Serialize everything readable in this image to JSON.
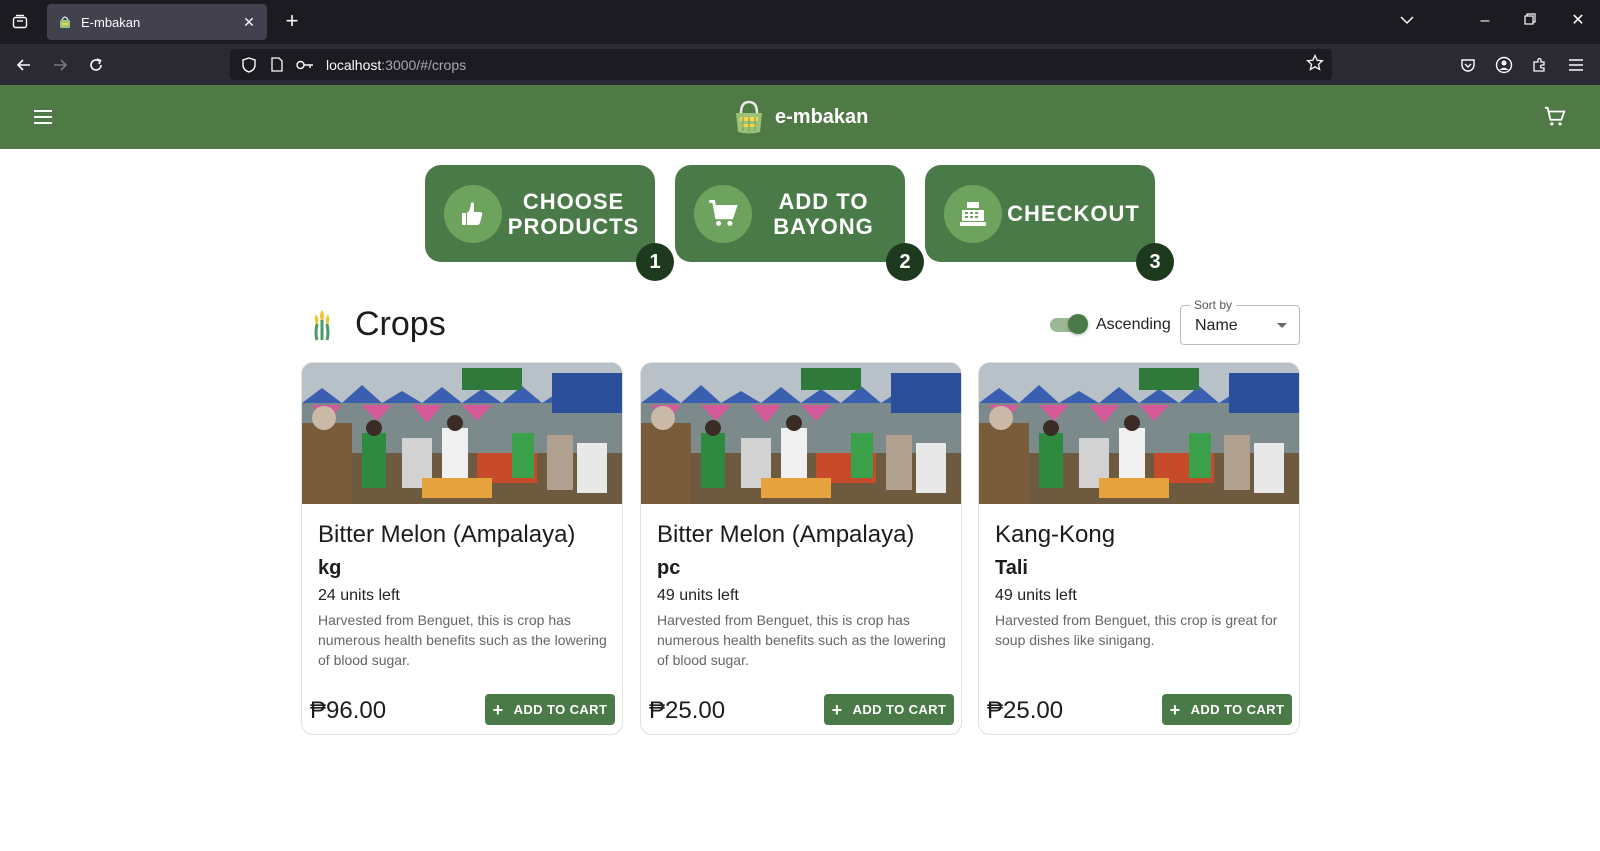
{
  "browser": {
    "tab_title": "E-mbakan",
    "url_host": "localhost",
    "url_rest": ":3000/#/crops"
  },
  "app": {
    "brand": "e-mbakan"
  },
  "steps": [
    {
      "label_line1": "CHOOSE",
      "label_line2": "PRODUCTS",
      "number": "1",
      "icon": "hand-pointing-icon"
    },
    {
      "label_line1": "ADD TO",
      "label_line2": "BAYONG",
      "number": "2",
      "icon": "cart-icon"
    },
    {
      "label_line1": "CHECKOUT",
      "label_line2": "",
      "number": "3",
      "icon": "cash-register-icon"
    }
  ],
  "section": {
    "title": "Crops",
    "toggle_label": "Ascending",
    "toggle_on": true,
    "sort_legend": "Sort by",
    "sort_value": "Name"
  },
  "products": [
    {
      "name": "Bitter Melon (Ampalaya)",
      "unit": "kg",
      "stock": "24 units left",
      "description": "Harvested from Benguet, this is crop has numerous health benefits such as the lowering of blood sugar.",
      "price": "₱96.00",
      "button": "ADD TO CART"
    },
    {
      "name": "Bitter Melon (Ampalaya)",
      "unit": "pc",
      "stock": "49 units left",
      "description": "Harvested from Benguet, this is crop has numerous health benefits such as the lowering of blood sugar.",
      "price": "₱25.00",
      "button": "ADD TO CART"
    },
    {
      "name": "Kang-Kong",
      "unit": "Tali",
      "stock": "49 units left",
      "description": "Harvested from Benguet, this crop is great for soup dishes like sinigang.",
      "price": "₱25.00",
      "button": "ADD TO CART"
    }
  ],
  "colors": {
    "primary": "#4f7a45",
    "step_bg": "#4a7a47",
    "step_num_bg": "#1e3a1e"
  }
}
